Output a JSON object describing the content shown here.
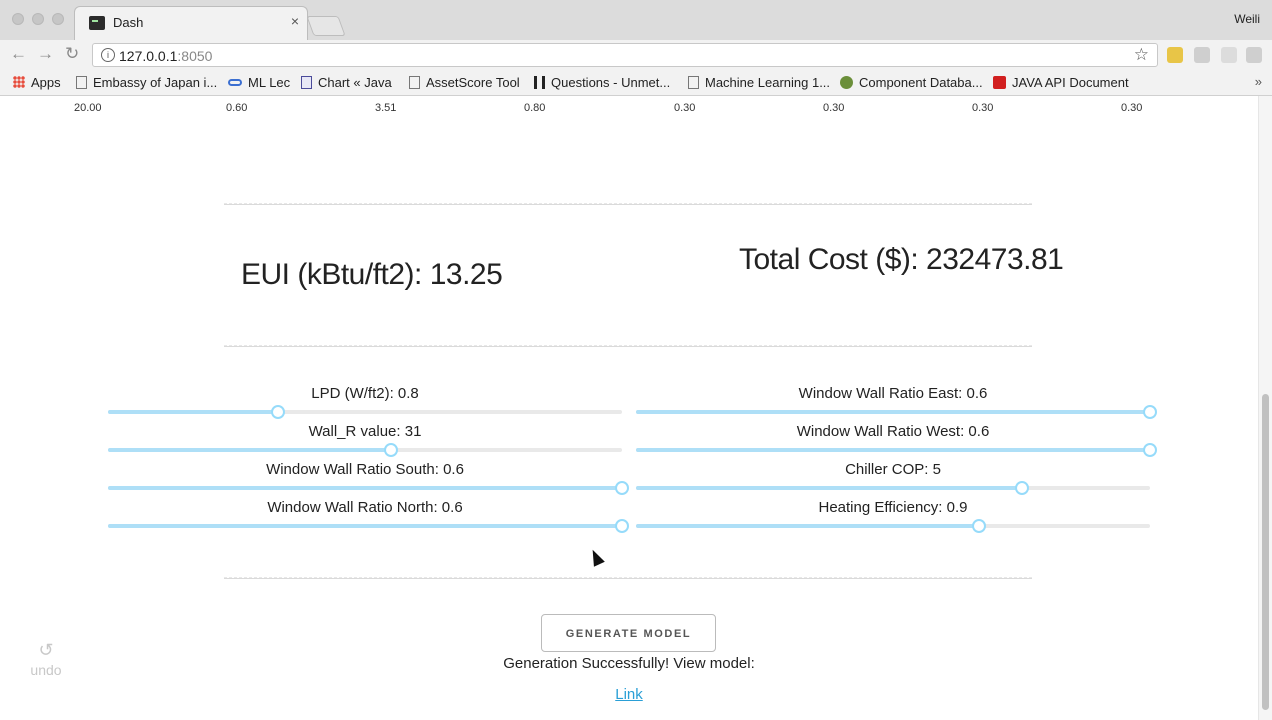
{
  "browser": {
    "tab_title": "Dash",
    "tab_close": "×",
    "user_name": "Weili",
    "url_host": "127.0.0.1",
    "url_port": ":8050",
    "nav": {
      "back": "←",
      "forward": "→",
      "reload": "↻"
    },
    "star": "☆",
    "bookmarks": [
      {
        "label": "Apps",
        "icon": "apps-grid-icon"
      },
      {
        "label": "Embassy of Japan i...",
        "icon": "page-icon"
      },
      {
        "label": "ML Lec",
        "icon": "link-icon"
      },
      {
        "label": "Chart « Java",
        "icon": "chart-icon"
      },
      {
        "label": "AssetScore Tool",
        "icon": "page-icon"
      },
      {
        "label": "Questions - Unmet...",
        "icon": "u-logo-icon"
      },
      {
        "label": "Machine Learning 1...",
        "icon": "page-icon"
      },
      {
        "label": "Component Databa...",
        "icon": "globe-icon"
      },
      {
        "label": "JAVA API Document",
        "icon": "oracle-icon"
      }
    ],
    "more": "»"
  },
  "table_row": [
    "20.00",
    "0.60",
    "3.51",
    "0.80",
    "0.30",
    "0.30",
    "0.30",
    "0.30"
  ],
  "metrics": {
    "eui": "EUI (kBtu/ft2): 13.25",
    "total_cost": "Total Cost ($): 232473.81"
  },
  "sliders": {
    "left": [
      {
        "label": "LPD (W/ft2): 0.8",
        "fraction": 0.33
      },
      {
        "label": "Wall_R value: 31",
        "fraction": 0.55
      },
      {
        "label": "Window Wall Ratio South: 0.6",
        "fraction": 1.0
      },
      {
        "label": "Window Wall Ratio North: 0.6",
        "fraction": 1.0
      }
    ],
    "right": [
      {
        "label": "Window Wall Ratio East: 0.6",
        "fraction": 1.0
      },
      {
        "label": "Window Wall Ratio West: 0.6",
        "fraction": 1.0
      },
      {
        "label": "Chiller COP: 5",
        "fraction": 0.75
      },
      {
        "label": "Heating Efficiency: 0.9",
        "fraction": 0.667
      }
    ]
  },
  "generate": {
    "button": "GENERATE MODEL",
    "message": "Generation Successfully! View model:",
    "link": "Link"
  },
  "undo": {
    "icon": "↺",
    "label": "undo"
  },
  "colors": {
    "slider_fill": "#aedff7",
    "slider_handle": "#96dbfa",
    "link": "#2a9fd6"
  }
}
